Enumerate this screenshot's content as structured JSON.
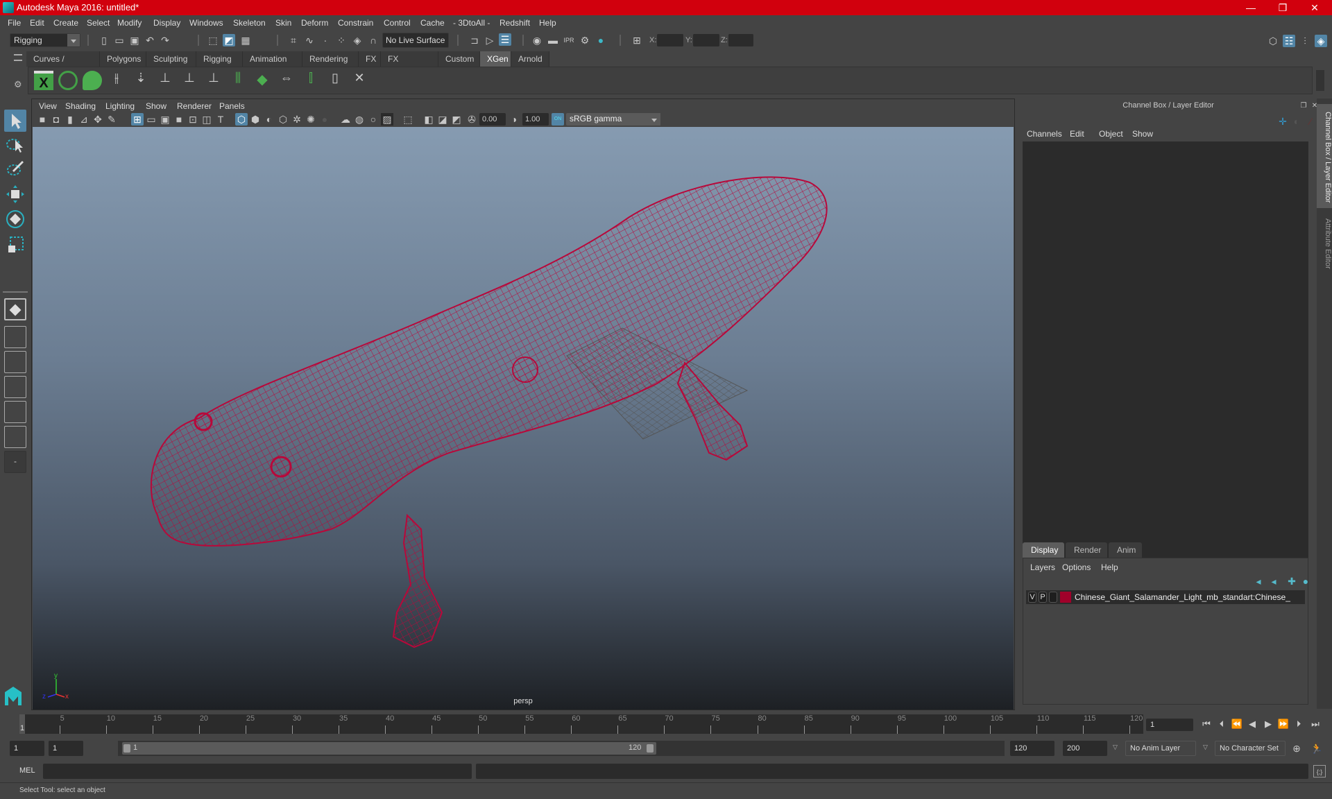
{
  "window": {
    "title": "Autodesk Maya 2016: untitled*",
    "minimize": "—",
    "restore": "❐",
    "close": "✕"
  },
  "menubar": [
    "File",
    "Edit",
    "Create",
    "Select",
    "Modify",
    "Display",
    "Windows",
    "Skeleton",
    "Skin",
    "Deform",
    "Constrain",
    "Control",
    "Cache",
    "- 3DtoAll -",
    "Redshift",
    "Help"
  ],
  "statusline": {
    "menuset": "Rigging",
    "live_surface": "No Live Surface",
    "x_label": "X:",
    "y_label": "Y:",
    "z_label": "Z:",
    "x_value": "",
    "y_value": "",
    "z_value": ""
  },
  "shelf": {
    "tabs": [
      "Curves / Surfaces",
      "Polygons",
      "Sculpting",
      "Rigging",
      "Animation",
      "Rendering",
      "FX",
      "FX Caching",
      "Custom",
      "XGen",
      "Arnold"
    ],
    "active_tab": "XGen",
    "icons": [
      "xgen-editor-icon",
      "xgen-preview-icon",
      "xgen-create-description-icon",
      "xgen-add-guide-icon",
      "xgen-place-guides-icon",
      "xgen-add-guide-2-icon",
      "xgen-guide-visibility-icon",
      "xgen-lock-guides-icon",
      "xgen-split-guides-icon",
      "xgen-guide-grid-icon",
      "xgen-rebuild-icon",
      "xgen-select-guides-icon",
      "xgen-guide-box-icon",
      "xgen-delete-guides-icon"
    ]
  },
  "viewport": {
    "menu": [
      "View",
      "Shading",
      "Lighting",
      "Show",
      "Renderer",
      "Panels"
    ],
    "exposure": "0.00",
    "gamma": "1.00",
    "color_mgmt_toggle": "ON",
    "color_space": "sRGB gamma",
    "camera_label": "persp",
    "axis": {
      "x": "x",
      "y": "y",
      "z": "z"
    },
    "wireframe_color": "#b8083a"
  },
  "right_panel": {
    "title": "Channel Box / Layer Editor",
    "channel_menu": [
      "Channels",
      "Edit",
      "Object",
      "Show"
    ],
    "layer_tabs": [
      "Display",
      "Render",
      "Anim"
    ],
    "active_layer_tab": "Display",
    "layer_menu": [
      "Layers",
      "Options",
      "Help"
    ],
    "layers": [
      {
        "v": "V",
        "p": "P",
        "color": "#a0002a",
        "name": "Chinese_Giant_Salamander_Light_mb_standart:Chinese_"
      }
    ],
    "side_tabs": [
      "Channel Box / Layer Editor",
      "Attribute Editor"
    ]
  },
  "timeline": {
    "ticks": [
      5,
      10,
      15,
      20,
      25,
      30,
      35,
      40,
      45,
      50,
      55,
      60,
      65,
      70,
      75,
      80,
      85,
      90,
      95,
      100,
      105,
      110,
      115,
      120
    ],
    "start": 1,
    "end": 120,
    "current_frame_marker": "1",
    "current_frame": "1"
  },
  "range": {
    "start_frame": "1",
    "playback_start": "1",
    "slider_start_label": "1",
    "slider_end_label": "120",
    "playback_end": "120",
    "end_frame": "200",
    "anim_layer": "No Anim Layer",
    "character_set": "No Character Set"
  },
  "command_line": {
    "label": "MEL",
    "value": ""
  },
  "help_line": "Select Tool: select an object"
}
